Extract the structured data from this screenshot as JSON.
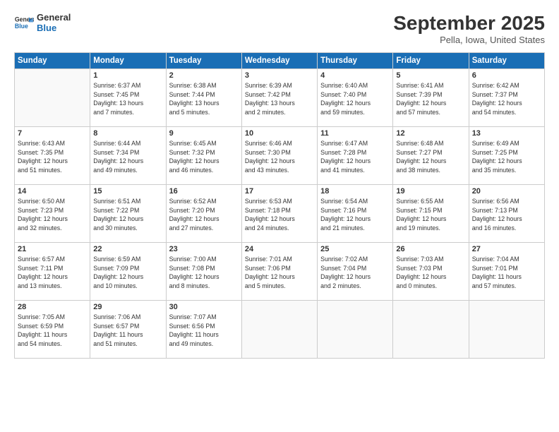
{
  "header": {
    "logo_line1": "General",
    "logo_line2": "Blue",
    "month": "September 2025",
    "location": "Pella, Iowa, United States"
  },
  "weekdays": [
    "Sunday",
    "Monday",
    "Tuesday",
    "Wednesday",
    "Thursday",
    "Friday",
    "Saturday"
  ],
  "weeks": [
    [
      {
        "day": "",
        "info": ""
      },
      {
        "day": "1",
        "info": "Sunrise: 6:37 AM\nSunset: 7:45 PM\nDaylight: 13 hours\nand 7 minutes."
      },
      {
        "day": "2",
        "info": "Sunrise: 6:38 AM\nSunset: 7:44 PM\nDaylight: 13 hours\nand 5 minutes."
      },
      {
        "day": "3",
        "info": "Sunrise: 6:39 AM\nSunset: 7:42 PM\nDaylight: 13 hours\nand 2 minutes."
      },
      {
        "day": "4",
        "info": "Sunrise: 6:40 AM\nSunset: 7:40 PM\nDaylight: 12 hours\nand 59 minutes."
      },
      {
        "day": "5",
        "info": "Sunrise: 6:41 AM\nSunset: 7:39 PM\nDaylight: 12 hours\nand 57 minutes."
      },
      {
        "day": "6",
        "info": "Sunrise: 6:42 AM\nSunset: 7:37 PM\nDaylight: 12 hours\nand 54 minutes."
      }
    ],
    [
      {
        "day": "7",
        "info": "Sunrise: 6:43 AM\nSunset: 7:35 PM\nDaylight: 12 hours\nand 51 minutes."
      },
      {
        "day": "8",
        "info": "Sunrise: 6:44 AM\nSunset: 7:34 PM\nDaylight: 12 hours\nand 49 minutes."
      },
      {
        "day": "9",
        "info": "Sunrise: 6:45 AM\nSunset: 7:32 PM\nDaylight: 12 hours\nand 46 minutes."
      },
      {
        "day": "10",
        "info": "Sunrise: 6:46 AM\nSunset: 7:30 PM\nDaylight: 12 hours\nand 43 minutes."
      },
      {
        "day": "11",
        "info": "Sunrise: 6:47 AM\nSunset: 7:28 PM\nDaylight: 12 hours\nand 41 minutes."
      },
      {
        "day": "12",
        "info": "Sunrise: 6:48 AM\nSunset: 7:27 PM\nDaylight: 12 hours\nand 38 minutes."
      },
      {
        "day": "13",
        "info": "Sunrise: 6:49 AM\nSunset: 7:25 PM\nDaylight: 12 hours\nand 35 minutes."
      }
    ],
    [
      {
        "day": "14",
        "info": "Sunrise: 6:50 AM\nSunset: 7:23 PM\nDaylight: 12 hours\nand 32 minutes."
      },
      {
        "day": "15",
        "info": "Sunrise: 6:51 AM\nSunset: 7:22 PM\nDaylight: 12 hours\nand 30 minutes."
      },
      {
        "day": "16",
        "info": "Sunrise: 6:52 AM\nSunset: 7:20 PM\nDaylight: 12 hours\nand 27 minutes."
      },
      {
        "day": "17",
        "info": "Sunrise: 6:53 AM\nSunset: 7:18 PM\nDaylight: 12 hours\nand 24 minutes."
      },
      {
        "day": "18",
        "info": "Sunrise: 6:54 AM\nSunset: 7:16 PM\nDaylight: 12 hours\nand 21 minutes."
      },
      {
        "day": "19",
        "info": "Sunrise: 6:55 AM\nSunset: 7:15 PM\nDaylight: 12 hours\nand 19 minutes."
      },
      {
        "day": "20",
        "info": "Sunrise: 6:56 AM\nSunset: 7:13 PM\nDaylight: 12 hours\nand 16 minutes."
      }
    ],
    [
      {
        "day": "21",
        "info": "Sunrise: 6:57 AM\nSunset: 7:11 PM\nDaylight: 12 hours\nand 13 minutes."
      },
      {
        "day": "22",
        "info": "Sunrise: 6:59 AM\nSunset: 7:09 PM\nDaylight: 12 hours\nand 10 minutes."
      },
      {
        "day": "23",
        "info": "Sunrise: 7:00 AM\nSunset: 7:08 PM\nDaylight: 12 hours\nand 8 minutes."
      },
      {
        "day": "24",
        "info": "Sunrise: 7:01 AM\nSunset: 7:06 PM\nDaylight: 12 hours\nand 5 minutes."
      },
      {
        "day": "25",
        "info": "Sunrise: 7:02 AM\nSunset: 7:04 PM\nDaylight: 12 hours\nand 2 minutes."
      },
      {
        "day": "26",
        "info": "Sunrise: 7:03 AM\nSunset: 7:03 PM\nDaylight: 12 hours\nand 0 minutes."
      },
      {
        "day": "27",
        "info": "Sunrise: 7:04 AM\nSunset: 7:01 PM\nDaylight: 11 hours\nand 57 minutes."
      }
    ],
    [
      {
        "day": "28",
        "info": "Sunrise: 7:05 AM\nSunset: 6:59 PM\nDaylight: 11 hours\nand 54 minutes."
      },
      {
        "day": "29",
        "info": "Sunrise: 7:06 AM\nSunset: 6:57 PM\nDaylight: 11 hours\nand 51 minutes."
      },
      {
        "day": "30",
        "info": "Sunrise: 7:07 AM\nSunset: 6:56 PM\nDaylight: 11 hours\nand 49 minutes."
      },
      {
        "day": "",
        "info": ""
      },
      {
        "day": "",
        "info": ""
      },
      {
        "day": "",
        "info": ""
      },
      {
        "day": "",
        "info": ""
      }
    ]
  ]
}
